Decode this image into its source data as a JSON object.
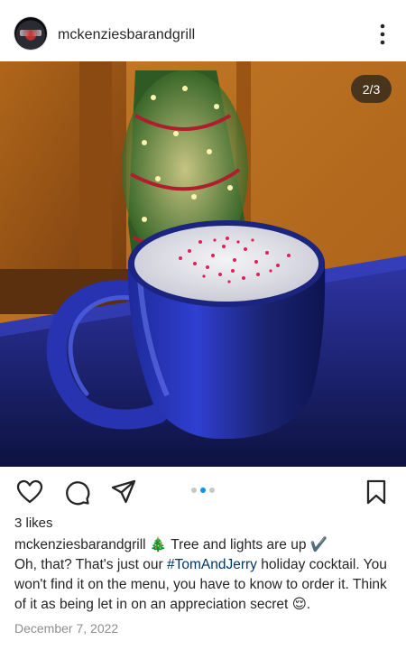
{
  "header": {
    "username": "mckenziesbarandgrill",
    "avatar_icon": "restaurant-logo-avatar",
    "more_icon": "more-vertical-icon"
  },
  "photo": {
    "counter": "2/3",
    "description_icon": "holiday-cocktail-photo"
  },
  "actions": {
    "like_icon": "heart-icon",
    "comment_icon": "comment-icon",
    "share_icon": "send-icon",
    "save_icon": "bookmark-icon",
    "carousel_dots": [
      false,
      true,
      false
    ]
  },
  "post": {
    "likes": "3 likes",
    "caption_user": "mckenziesbarandgrill",
    "caption_line1": " 🎄 Tree and lights are up ✔️",
    "caption_pre": "Oh, that? That's just our ",
    "hashtag": "#TomAndJerry",
    "caption_post": " holiday cocktail. You won't find it on the menu, you have to know to order it. Think of it as being let in on an appreciation secret 😌.",
    "date": "December 7, 2022"
  },
  "colors": {
    "accent": "#0095f6",
    "hashtag": "#00376b",
    "muted": "#8e8e8e"
  }
}
